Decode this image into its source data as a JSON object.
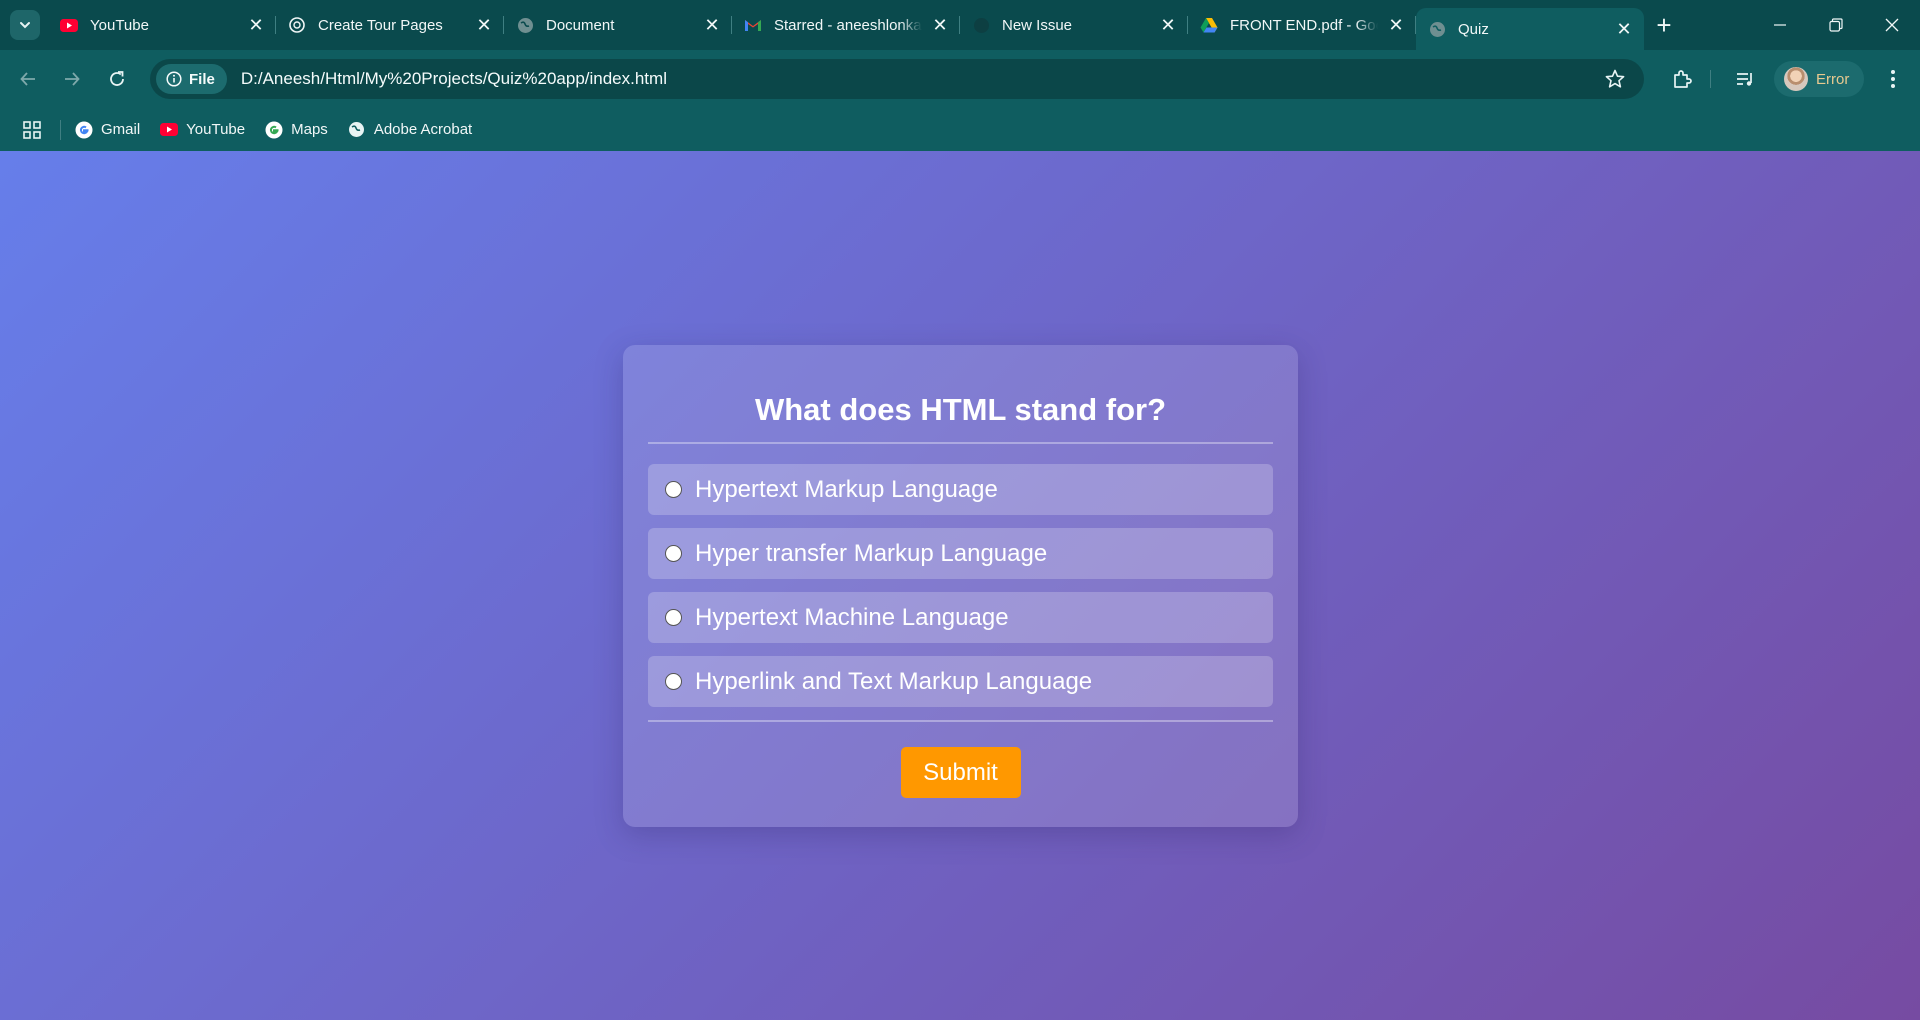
{
  "browser": {
    "tabs": [
      {
        "title": "YouTube",
        "icon": "youtube-icon",
        "active": false
      },
      {
        "title": "Create Tour Pages",
        "icon": "chatgpt-icon",
        "active": false
      },
      {
        "title": "Document",
        "icon": "globe-icon",
        "active": false
      },
      {
        "title": "Starred - aneeshlonkar",
        "icon": "gmail-icon",
        "active": false
      },
      {
        "title": "New Issue",
        "icon": "github-icon",
        "active": false
      },
      {
        "title": "FRONT END.pdf - Google Drive",
        "icon": "google-drive-icon",
        "active": false
      },
      {
        "title": "Quiz",
        "icon": "globe-icon",
        "active": true
      }
    ],
    "omnibox": {
      "chip_label": "File",
      "url": "D:/Aneesh/Html/My%20Projects/Quiz%20app/index.html"
    },
    "profile": {
      "label": "Error"
    },
    "bookmarks": [
      {
        "label": "Gmail",
        "icon": "google-icon"
      },
      {
        "label": "YouTube",
        "icon": "youtube-icon"
      },
      {
        "label": "Maps",
        "icon": "google-icon"
      },
      {
        "label": "Adobe Acrobat",
        "icon": "globe-icon"
      }
    ]
  },
  "quiz": {
    "question": "What does HTML stand for?",
    "options": [
      {
        "label": "Hypertext Markup Language",
        "selected": false
      },
      {
        "label": "Hyper transfer Markup Language",
        "selected": false
      },
      {
        "label": "Hypertext Machine Language",
        "selected": false
      },
      {
        "label": "Hyperlink and Text Markup Language",
        "selected": false
      }
    ],
    "submit_label": "Submit"
  },
  "colors": {
    "browser_frame": "#0f5d60",
    "gradient_start": "#667eea",
    "gradient_end": "#764ba2",
    "submit_button": "#ff9800"
  }
}
